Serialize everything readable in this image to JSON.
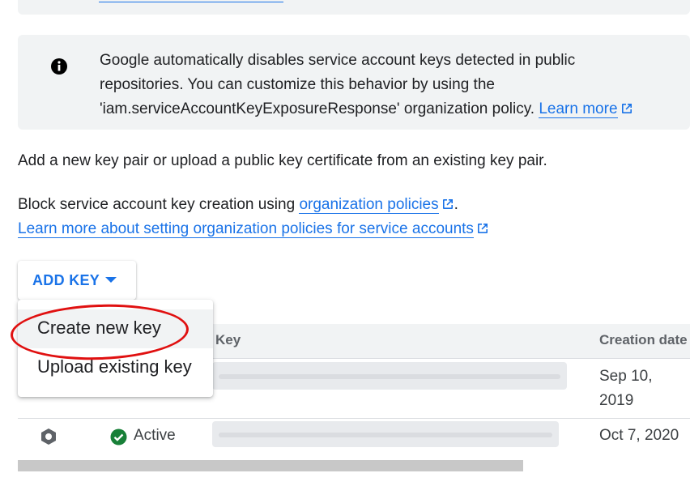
{
  "info_box": {
    "line1": "Google automatically disables service account keys detected in public",
    "line2": "repositories. You can customize this behavior by using the",
    "line3": "'iam.serviceAccountKeyExposureResponse' organization policy.",
    "learn_more": "Learn more"
  },
  "intro": {
    "add_text": "Add a new key pair or upload a public key certificate from an existing key pair.",
    "block_prefix": "Block service account key creation using ",
    "block_link": "organization policies",
    "block_suffix": ".",
    "learn_more_policies": "Learn more about setting organization policies for service accounts"
  },
  "add_key": {
    "label": "ADD KEY"
  },
  "menu": {
    "items": [
      {
        "label": "Create new key"
      },
      {
        "label": "Upload existing key"
      }
    ]
  },
  "table": {
    "headers": {
      "key": "Key",
      "creation_date": "Creation date"
    },
    "rows": [
      {
        "status": "",
        "date_line1": "Sep 10,",
        "date_line2": "2019"
      },
      {
        "status": "Active",
        "date": "Oct 7, 2020"
      }
    ]
  },
  "colors": {
    "link": "#1a73e8",
    "annotation": "#e01010",
    "active": "#188038"
  },
  "icons": [
    "info-icon",
    "external-link-icon",
    "caret-down-icon",
    "key-hex-icon",
    "check-circle-icon"
  ]
}
